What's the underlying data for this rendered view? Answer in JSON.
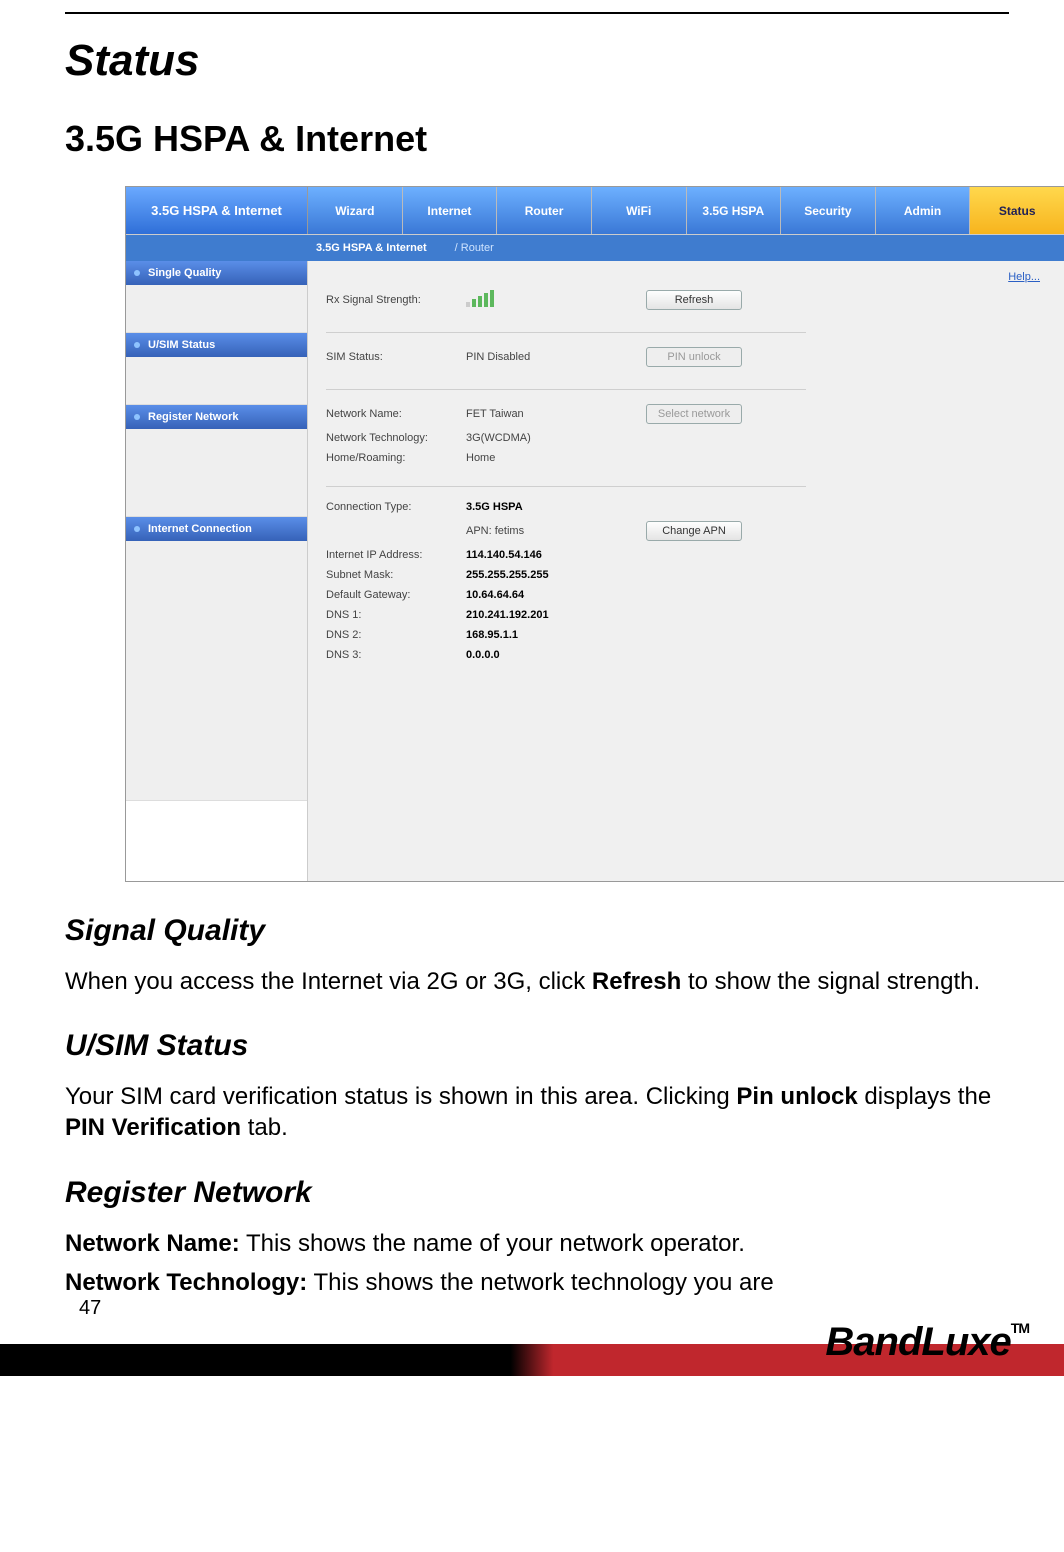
{
  "doc": {
    "title": "Status",
    "section": "3.5G HSPA & Internet",
    "signal_quality_heading": "Signal Quality",
    "signal_quality_text_pre": "When you access the Internet via 2G or 3G, click ",
    "signal_quality_text_bold": "Refresh",
    "signal_quality_text_post": " to show the signal strength.",
    "usim_heading": "U/SIM Status",
    "usim_text_pre": "Your SIM card verification status is shown in this area. Clicking ",
    "usim_text_bold1": "Pin unlock",
    "usim_text_mid": " displays the ",
    "usim_text_bold2": "PIN Verification",
    "usim_text_post": " tab.",
    "regnet_heading": "Register Network",
    "regnet_row1_label": "Network Name:",
    "regnet_row1_text": " This shows the name of your network operator.",
    "regnet_row2_label": "Network Technology:",
    "regnet_row2_text": " This shows the network technology you are",
    "page_number": "47",
    "brand": "BandLuxe",
    "tm": "TM"
  },
  "ui": {
    "side_title": "3.5G HSPA & Internet",
    "tabs": [
      "Wizard",
      "Internet",
      "Router",
      "WiFi",
      "3.5G HSPA",
      "Security",
      "Admin",
      "Status"
    ],
    "active_tab": "Status",
    "subtabs": [
      "3.5G HSPA & Internet",
      "/ Router"
    ],
    "active_subtab": "3.5G HSPA & Internet",
    "help": "Help...",
    "left_sections": [
      "Single Quality",
      "U/SIM Status",
      "Register Network",
      "Internet Connection"
    ],
    "signal": {
      "label": "Rx Signal Strength:",
      "refresh": "Refresh"
    },
    "sim": {
      "label": "SIM Status:",
      "value": "PIN Disabled",
      "button": "PIN unlock"
    },
    "register": {
      "name_label": "Network Name:",
      "name_value": "FET Taiwan",
      "tech_label": "Network Technology:",
      "tech_value": "3G(WCDMA)",
      "roam_label": "Home/Roaming:",
      "roam_value": "Home",
      "button": "Select network"
    },
    "internet": {
      "conn_label": "Connection Type:",
      "conn_value": "3.5G HSPA",
      "apn_label": "APN: fetims",
      "apn_button": "Change APN",
      "ip_label": "Internet IP Address:",
      "ip_value": "114.140.54.146",
      "mask_label": "Subnet Mask:",
      "mask_value": "255.255.255.255",
      "gw_label": "Default Gateway:",
      "gw_value": "10.64.64.64",
      "dns1_label": "DNS 1:",
      "dns1_value": "210.241.192.201",
      "dns2_label": "DNS 2:",
      "dns2_value": "168.95.1.1",
      "dns3_label": "DNS 3:",
      "dns3_value": "0.0.0.0"
    }
  }
}
